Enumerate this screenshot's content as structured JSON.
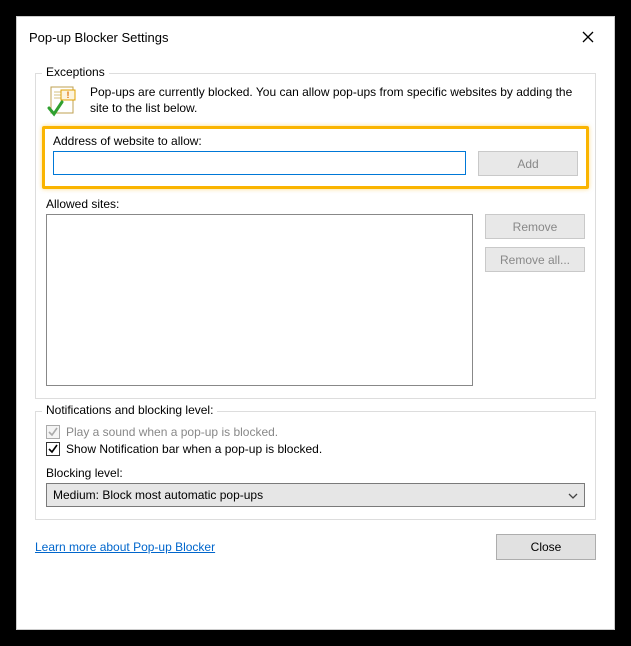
{
  "title": "Pop-up Blocker Settings",
  "exceptions": {
    "label": "Exceptions",
    "intro": "Pop-ups are currently blocked.  You can allow pop-ups from specific websites by adding the site to the list below.",
    "address_label": "Address of website to allow:",
    "address_value": "",
    "add_label": "Add",
    "allowed_label": "Allowed sites:",
    "remove_label": "Remove",
    "remove_all_label": "Remove all..."
  },
  "notifications": {
    "label": "Notifications and blocking level:",
    "sound_label": "Play a sound when a pop-up is blocked.",
    "bar_label": "Show Notification bar when a pop-up is blocked.",
    "blocking_label": "Blocking level:",
    "blocking_value": "Medium: Block most automatic pop-ups"
  },
  "footer": {
    "learn_more": "Learn more about Pop-up Blocker",
    "close": "Close"
  }
}
